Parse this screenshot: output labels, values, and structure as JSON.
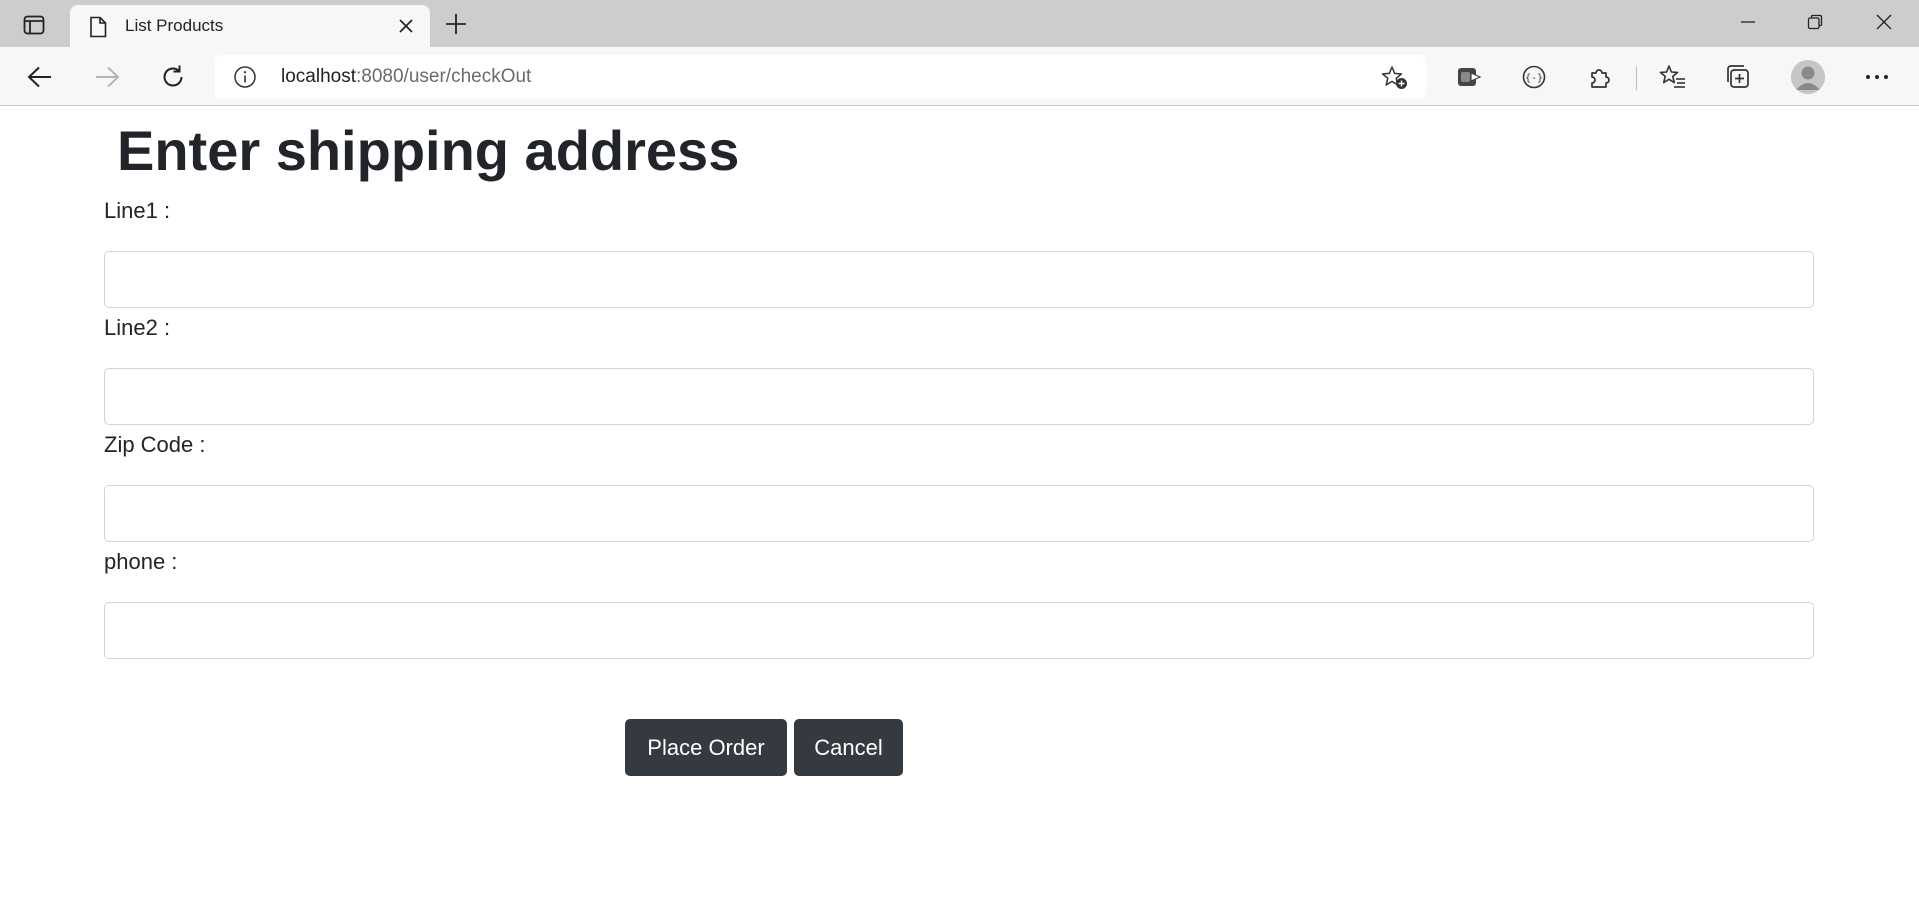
{
  "browser": {
    "tab": {
      "title": "List Products"
    },
    "address": {
      "host": "localhost",
      "rest": ":8080/user/checkOut"
    }
  },
  "page": {
    "title": "Enter shipping address",
    "fields": [
      {
        "label": "Line1 :",
        "value": ""
      },
      {
        "label": "Line2 :",
        "value": ""
      },
      {
        "label": "Zip Code :",
        "value": ""
      },
      {
        "label": "phone :",
        "value": ""
      }
    ],
    "buttons": {
      "place_order": "Place Order",
      "cancel": "Cancel"
    }
  },
  "colors": {
    "button_bg": "#343a40",
    "text": "#212529",
    "input_border": "#ced4da"
  }
}
